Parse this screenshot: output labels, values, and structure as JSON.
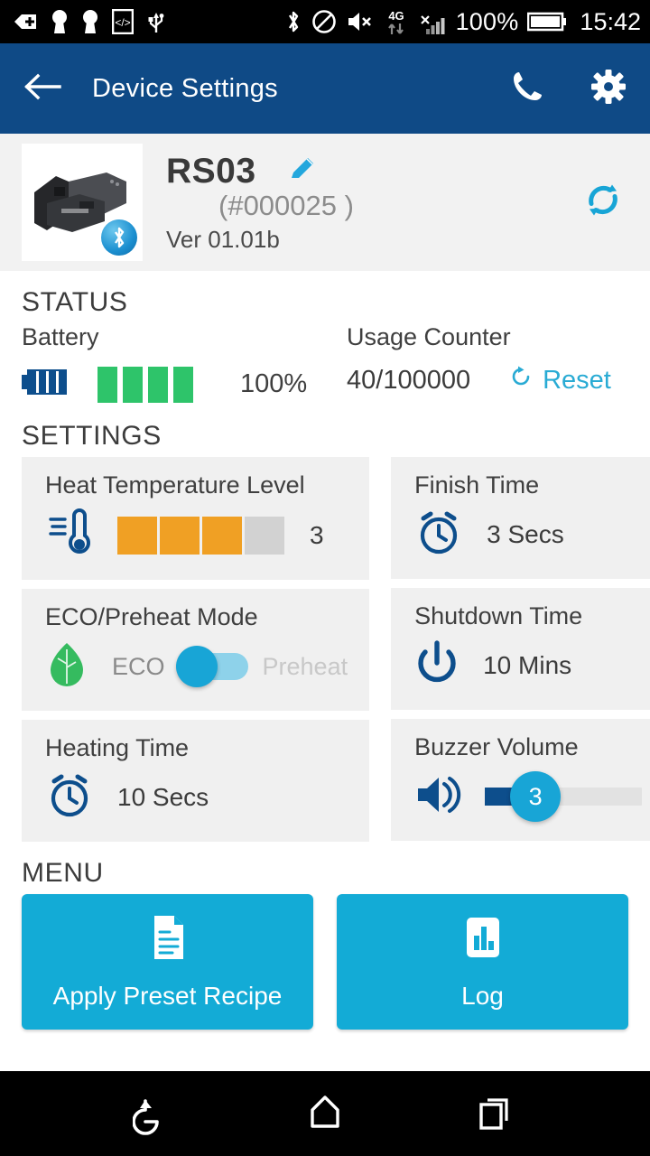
{
  "statusbar": {
    "left_icons": [
      "back-tag-icon",
      "key-icon",
      "key-icon",
      "developer-code-icon",
      "usb-icon"
    ],
    "right_icons": [
      "bluetooth-icon",
      "do-not-disturb-icon",
      "volume-mute-icon",
      "4g-data-icon",
      "signal-no-service-icon"
    ],
    "battery_percent": "100%",
    "network_label": "4G",
    "time": "15:42"
  },
  "appbar": {
    "back_icon": "back-arrow-icon",
    "title": "Device Settings",
    "call_icon": "phone-icon",
    "settings_icon": "gear-icon"
  },
  "device": {
    "thumbnail_alt": "device-photo",
    "bluetooth_badge": "bluetooth-icon",
    "name": "RS03",
    "edit_icon": "pencil-icon",
    "serial": "(#000025 )",
    "version": "Ver 01.01b",
    "sync_icon": "sync-icon"
  },
  "status": {
    "heading": "STATUS",
    "battery": {
      "label": "Battery",
      "icon": "battery-icon",
      "bars_total": 4,
      "bars_filled": 4,
      "percent": "100%",
      "fill_color": "#2ec46a"
    },
    "usage": {
      "label": "Usage Counter",
      "value": "40/100000",
      "count": 40,
      "max": 100000,
      "reset_label": "Reset",
      "reset_icon": "refresh-icon",
      "link_color": "#29abd4"
    }
  },
  "settings": {
    "heading": "SETTINGS",
    "heat": {
      "title": "Heat Temperature Level",
      "icon": "thermometer-icon",
      "bars_total": 4,
      "bars_filled": 3,
      "value": "3",
      "fill_color": "#f0a024"
    },
    "finish_time": {
      "title": "Finish Time",
      "icon": "alarm-clock-icon",
      "value": "3 Secs"
    },
    "eco": {
      "title": "ECO/Preheat Mode",
      "icon": "leaf-icon",
      "option_left": "ECO",
      "option_right": "Preheat",
      "selected": "ECO",
      "toggle_color": "#18a5d6"
    },
    "shutdown_time": {
      "title": "Shutdown Time",
      "icon": "power-icon",
      "value": "10 Mins"
    },
    "heating_time": {
      "title": "Heating Time",
      "icon": "alarm-clock-icon",
      "value": "10 Secs"
    },
    "buzzer": {
      "title": "Buzzer Volume",
      "icon": "speaker-icon",
      "value": "3",
      "min": 0,
      "max": 10,
      "thumb_color": "#18a5d6",
      "fill_color": "#0d4e8c"
    }
  },
  "menu": {
    "heading": "MENU",
    "items": [
      {
        "label": "Apply Preset Recipe",
        "icon": "document-icon"
      },
      {
        "label": "Log",
        "icon": "bar-chart-icon"
      }
    ],
    "card_color": "#13abd6"
  },
  "navbar": {
    "back_icon": "nav-back-icon",
    "home_icon": "nav-home-icon",
    "recents_icon": "nav-recents-icon"
  }
}
